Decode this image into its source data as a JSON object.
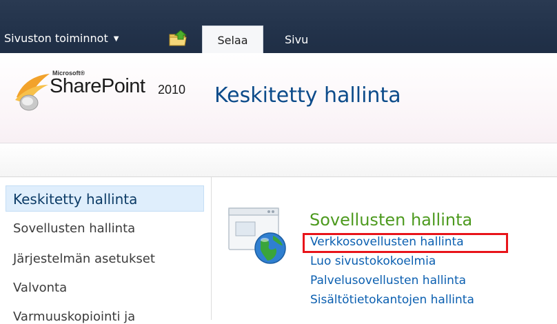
{
  "ribbon": {
    "site_actions_label": "Sivuston toiminnot",
    "tabs": [
      {
        "label": "Selaa",
        "selected": true
      },
      {
        "label": "Sivu",
        "selected": false
      }
    ]
  },
  "header": {
    "logo_microsoft": "Microsoft®",
    "logo_product": "SharePoint",
    "logo_version": "2010",
    "site_title": "Keskitetty hallinta"
  },
  "quick_launch": {
    "items": [
      {
        "label": "Keskitetty hallinta",
        "selected": true
      },
      {
        "label": "Sovellusten hallinta"
      },
      {
        "label": "Järjestelmän asetukset"
      },
      {
        "label": "Valvonta"
      },
      {
        "label": "Varmuuskopiointi ja"
      }
    ]
  },
  "main": {
    "section_title": "Sovellusten hallinta",
    "links": [
      {
        "label": "Verkkosovellusten hallinta",
        "highlighted": true
      },
      {
        "label": "Luo sivustokokoelmia"
      },
      {
        "label": "Palvelusovellusten hallinta"
      },
      {
        "label": "Sisältötietokantojen hallinta"
      }
    ]
  },
  "colors": {
    "ribbon_bg": "#22324a",
    "title_blue": "#0c4b8a",
    "section_green": "#4d9a1f",
    "link_blue": "#0b5fb0",
    "highlight_red": "#e8141a",
    "quick_launch_selected_bg": "#dfeefc"
  }
}
